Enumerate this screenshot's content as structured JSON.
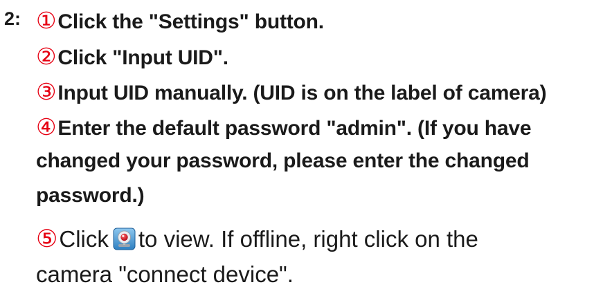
{
  "step": {
    "prefix": "2:"
  },
  "instructions": [
    {
      "marker": "①",
      "text": "Click the \"Settings\" button."
    },
    {
      "marker": "②",
      "text": "Click \"Input UID\"."
    },
    {
      "marker": "③",
      "text": "Input UID manually. (UID is on the label of camera)"
    },
    {
      "marker": "④",
      "text": "Enter the default password \"admin\". (If you have"
    },
    {
      "text": "changed your password, please enter the changed"
    },
    {
      "text": "password.)"
    }
  ],
  "final_step": {
    "marker": "⑤",
    "before_icon": "Click",
    "icon": "camera-view-icon",
    "after_icon": "to view. If offline, right click on the",
    "line2": "camera \"connect device\"."
  },
  "colors": {
    "marker_red": "#e60012",
    "text": "#1a1a1a"
  }
}
